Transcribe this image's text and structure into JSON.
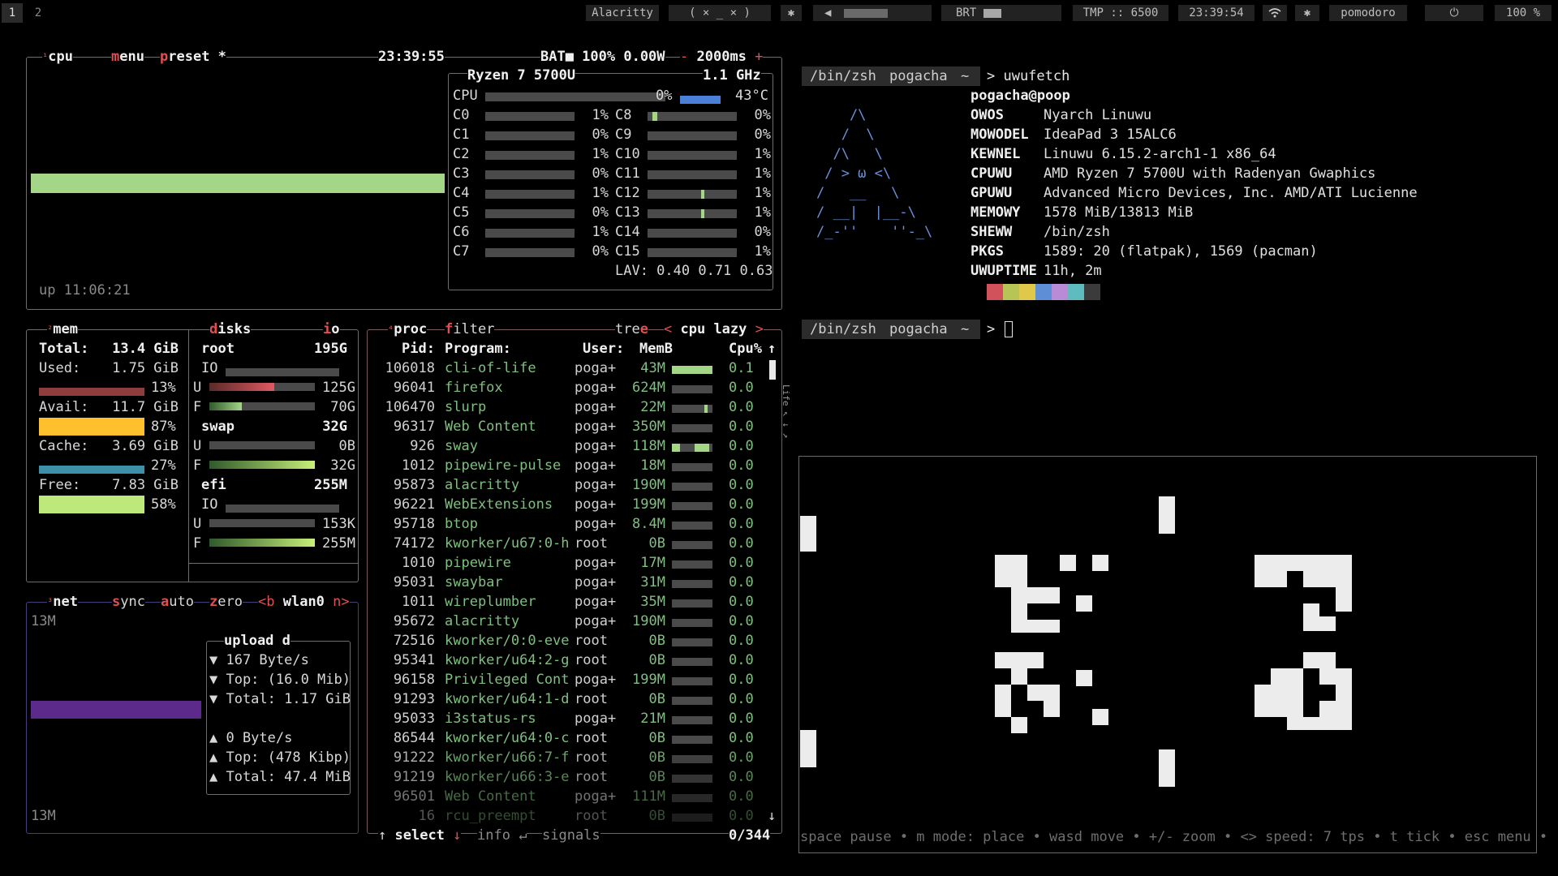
{
  "topbar": {
    "workspaces": [
      "1",
      "2"
    ],
    "window_title": "Alacritty",
    "window_controls": "( × _ × )",
    "bluetooth_left": "✱",
    "volume": "◀",
    "brightness_label": "BRT",
    "temp": "TMP :: 6500",
    "clock": "23:39:54",
    "bluetooth": "✱",
    "pomodoro": "pomodoro",
    "power": "⏻",
    "battery": "100 %"
  },
  "cpu": {
    "tab_num": "¹",
    "tab": "cpu",
    "menu": "menu",
    "preset": "preset *",
    "time": "23:39:55",
    "bat": "BAT■ 100% 0.00W",
    "minus": "-",
    "interval": "2000ms",
    "plus": "+",
    "uptime": "up 11:06:21",
    "model": "Ryzen 7 5700U",
    "freq": "1.1 GHz",
    "total_label": "CPU",
    "total_pct": "0%",
    "temp": "43°C",
    "lav": "LAV: 0.40 0.71 0.63",
    "cores_left": [
      {
        "name": "C0",
        "pct": "1%"
      },
      {
        "name": "C1",
        "pct": "0%"
      },
      {
        "name": "C2",
        "pct": "1%"
      },
      {
        "name": "C3",
        "pct": "0%"
      },
      {
        "name": "C4",
        "pct": "1%"
      },
      {
        "name": "C5",
        "pct": "0%"
      },
      {
        "name": "C6",
        "pct": "1%"
      },
      {
        "name": "C7",
        "pct": "0%"
      }
    ],
    "cores_right": [
      {
        "name": "C8",
        "pct": "0%"
      },
      {
        "name": "C9",
        "pct": "0%"
      },
      {
        "name": "C10",
        "pct": "1%"
      },
      {
        "name": "C11",
        "pct": "1%"
      },
      {
        "name": "C12",
        "pct": "1%"
      },
      {
        "name": "C13",
        "pct": "1%"
      },
      {
        "name": "C14",
        "pct": "0%"
      },
      {
        "name": "C15",
        "pct": "1%"
      }
    ]
  },
  "mem": {
    "tab_num": "²",
    "tab": "mem",
    "disks": "disks",
    "io": "io",
    "total_label": "Total:",
    "total": "13.4 GiB",
    "used_label": "Used:",
    "used": "1.75 GiB",
    "used_pct": "13%",
    "avail_label": "Avail:",
    "avail": "11.7 GiB",
    "avail_pct": "87%",
    "cache_label": "Cache:",
    "cache": "3.69 GiB",
    "cache_pct": "27%",
    "free_label": "Free:",
    "free": "7.83 GiB",
    "free_pct": "58%",
    "disks_list": [
      {
        "name": "root",
        "size": "195G",
        "io": "IO",
        "u": "U",
        "used": "125G",
        "f": "F",
        "free": "70G"
      },
      {
        "name": "swap",
        "size": "32G",
        "u": "U",
        "used": "0B",
        "f": "F",
        "free": "32G"
      },
      {
        "name": "efi",
        "size": "255M",
        "io": "IO",
        "u": "U",
        "used": "153K",
        "f": "F",
        "free": "255M"
      }
    ]
  },
  "net": {
    "tab_num": "³",
    "tab": "net",
    "sync": "sync",
    "auto": "auto",
    "zero": "zero",
    "prev": "<b",
    "iface": "wlan0",
    "next": "n>",
    "scale_top": "13M",
    "scale_bottom": "13M",
    "box_title": "upload d",
    "down_rate": "▼ 167 Byte/s",
    "down_top": "▼ Top: (16.0 Mib)",
    "down_total": "▼ Total: 1.17 GiB",
    "up_rate": "▲ 0 Byte/s",
    "up_top": "▲ Top: (478 Kibp)",
    "up_total": "▲ Total: 47.4 MiB"
  },
  "proc": {
    "tab_num": "⁴",
    "tab": "proc",
    "filter": "filter",
    "tree": "tree",
    "left_arrow": "<",
    "sort": "cpu lazy",
    "right_arrow": ">",
    "headers": {
      "pid": "Pid:",
      "program": "Program:",
      "user": "User:",
      "mem": "MemB",
      "cpu": "Cpu%"
    },
    "rows": [
      {
        "pid": "106018",
        "program": "cli-of-life",
        "user": "poga+",
        "mem": "43M",
        "cpu": "0.1"
      },
      {
        "pid": "96041",
        "program": "firefox",
        "user": "poga+",
        "mem": "624M",
        "cpu": "0.0"
      },
      {
        "pid": "106470",
        "program": "slurp",
        "user": "poga+",
        "mem": "22M",
        "cpu": "0.0"
      },
      {
        "pid": "96317",
        "program": "Web Content",
        "user": "poga+",
        "mem": "350M",
        "cpu": "0.0"
      },
      {
        "pid": "926",
        "program": "sway",
        "user": "poga+",
        "mem": "118M",
        "cpu": "0.0"
      },
      {
        "pid": "1012",
        "program": "pipewire-pulse",
        "user": "poga+",
        "mem": "18M",
        "cpu": "0.0"
      },
      {
        "pid": "95873",
        "program": "alacritty",
        "user": "poga+",
        "mem": "190M",
        "cpu": "0.0"
      },
      {
        "pid": "96221",
        "program": "WebExtensions",
        "user": "poga+",
        "mem": "199M",
        "cpu": "0.0"
      },
      {
        "pid": "95718",
        "program": "btop",
        "user": "poga+",
        "mem": "8.4M",
        "cpu": "0.0"
      },
      {
        "pid": "74172",
        "program": "kworker/u67:0-h",
        "user": "root",
        "mem": "0B",
        "cpu": "0.0"
      },
      {
        "pid": "1010",
        "program": "pipewire",
        "user": "poga+",
        "mem": "17M",
        "cpu": "0.0"
      },
      {
        "pid": "95031",
        "program": "swaybar",
        "user": "poga+",
        "mem": "31M",
        "cpu": "0.0"
      },
      {
        "pid": "1011",
        "program": "wireplumber",
        "user": "poga+",
        "mem": "35M",
        "cpu": "0.0"
      },
      {
        "pid": "95672",
        "program": "alacritty",
        "user": "poga+",
        "mem": "190M",
        "cpu": "0.0"
      },
      {
        "pid": "72516",
        "program": "kworker/0:0-eve",
        "user": "root",
        "mem": "0B",
        "cpu": "0.0"
      },
      {
        "pid": "95341",
        "program": "kworker/u64:2-g",
        "user": "root",
        "mem": "0B",
        "cpu": "0.0"
      },
      {
        "pid": "96158",
        "program": "Privileged Cont",
        "user": "poga+",
        "mem": "199M",
        "cpu": "0.0"
      },
      {
        "pid": "91293",
        "program": "kworker/u64:1-d",
        "user": "root",
        "mem": "0B",
        "cpu": "0.0"
      },
      {
        "pid": "95033",
        "program": "i3status-rs",
        "user": "poga+",
        "mem": "21M",
        "cpu": "0.0"
      },
      {
        "pid": "86544",
        "program": "kworker/u64:0-c",
        "user": "root",
        "mem": "0B",
        "cpu": "0.0"
      },
      {
        "pid": "91222",
        "program": "kworker/u66:7-f",
        "user": "root",
        "mem": "0B",
        "cpu": "0.0"
      },
      {
        "pid": "91219",
        "program": "kworker/u66:3-e",
        "user": "root",
        "mem": "0B",
        "cpu": "0.0"
      },
      {
        "pid": "96501",
        "program": "Web Content",
        "user": "poga+",
        "mem": "111M",
        "cpu": "0.0"
      },
      {
        "pid": "16",
        "program": "rcu_preempt",
        "user": "root",
        "mem": "0B",
        "cpu": "0.0"
      }
    ],
    "footer_up": "↑",
    "select": "select",
    "footer_down": "↓",
    "info": "info",
    "enter": "↵",
    "signals": "signals",
    "count": "0/344",
    "sort_arrow": "↑",
    "scroll_down": "↓"
  },
  "terminal": {
    "prompt1": {
      "shell": "/bin/zsh",
      "host": "pogacha",
      "dir": "~",
      "cmd": "> uwufetch"
    },
    "ascii": [
      "    /\\",
      "   /  \\",
      "  /\\   \\",
      " / > ω <\\",
      "/   __   \\",
      "/ __|  |__-\\",
      "/_-''    ''-_\\"
    ],
    "user": "pogacha@poop",
    "info": [
      {
        "k": "OWOS",
        "v": "Nyarch Linuwu"
      },
      {
        "k": "MOWODEL",
        "v": "IdeaPad 3 15ALC6"
      },
      {
        "k": "KEWNEL",
        "v": "Linuwu 6.15.2-arch1-1 x86_64"
      },
      {
        "k": "CPUWU",
        "v": "AMD Ryzen 7 5700U with Radenyan Gwaphics"
      },
      {
        "k": "GPUWU",
        "v": "Advanced Micro Devices, Inc. AMD/ATI Lucienne"
      },
      {
        "k": "MEMOWY",
        "v": "1578 MiB/13813 MiB"
      },
      {
        "k": "SHEWW",
        "v": "/bin/zsh"
      },
      {
        "k": "PKGS",
        "v": "1589: 20 (flatpak), 1569 (pacman)"
      },
      {
        "k": "UWUPTIME",
        "v": "11h, 2m"
      }
    ],
    "palette": [
      "#d2525c",
      "#b6c556",
      "#e0c84a",
      "#5e8fd6",
      "#b98bd6",
      "#5ebcbf",
      "#3b3b3b"
    ],
    "prompt2": {
      "shell": "/bin/zsh",
      "host": "pogacha",
      "dir": "~",
      "cmd": ">"
    }
  },
  "life": {
    "side_text": "Life ↖ ↓ ↗",
    "hint": "space pause • m mode: place • wasd move • +/- zoom • <> speed: 7 tps • t tick • esc menu •"
  },
  "colors": {
    "accent_green": "#a4d688",
    "mem_used": "#8f3c3c",
    "mem_avail": "#ffc02e",
    "mem_cache": "#3e8fa8",
    "mem_free": "#bde87a",
    "net_bar": "#5c2a8a",
    "cpu_temp_bar": "#4a80d8"
  }
}
